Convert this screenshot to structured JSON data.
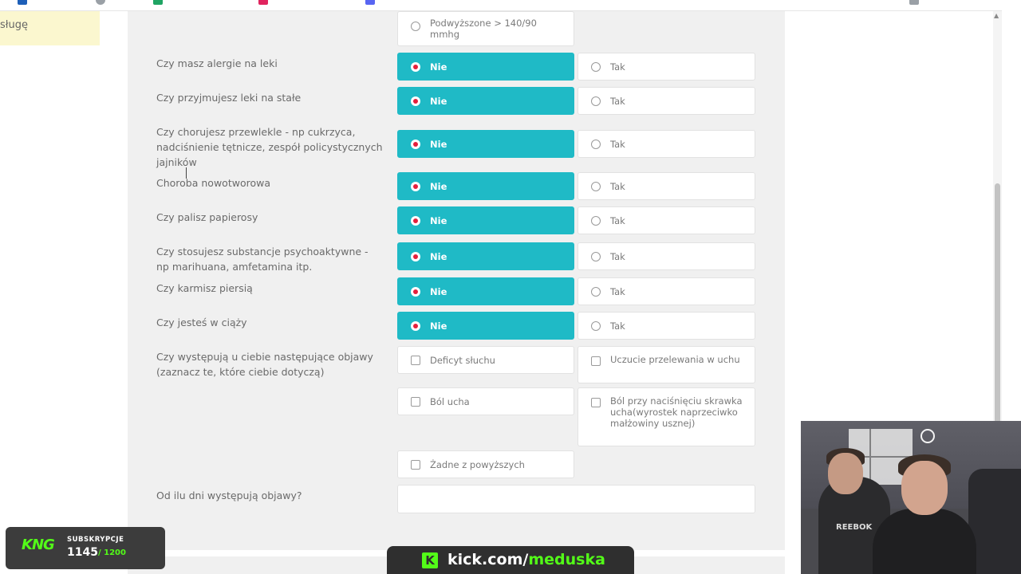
{
  "left_note": {
    "text": "sługę"
  },
  "bp_option": {
    "label": "Podwyższone > 140/90 mmhg"
  },
  "questions": [
    {
      "label": "Czy masz alergie na leki",
      "yes": "Tak",
      "no": "Nie",
      "selected": "Nie"
    },
    {
      "label": "Czy przyjmujesz leki na stałe",
      "yes": "Tak",
      "no": "Nie",
      "selected": "Nie"
    },
    {
      "label": "Czy chorujesz przewlekle - np cukrzyca, nadciśnienie tętnicze, zespół policystycznych jajników",
      "yes": "Tak",
      "no": "Nie",
      "selected": "Nie"
    },
    {
      "label": "Choroba nowotworowa",
      "yes": "Tak",
      "no": "Nie",
      "selected": "Nie"
    },
    {
      "label": "Czy palisz papierosy",
      "yes": "Tak",
      "no": "Nie",
      "selected": "Nie"
    },
    {
      "label": "Czy stosujesz substancje psychoaktywne - np marihuana, amfetamina itp.",
      "yes": "Tak",
      "no": "Nie",
      "selected": "Nie"
    },
    {
      "label": "Czy karmisz piersią",
      "yes": "Tak",
      "no": "Nie",
      "selected": "Nie"
    },
    {
      "label": "Czy jesteś w ciąży",
      "yes": "Tak",
      "no": "Nie",
      "selected": "Nie"
    }
  ],
  "symptoms": {
    "label": "Czy występują u ciebie następujące objawy (zaznacz te, które ciebie dotyczą)",
    "options": [
      "Deficyt słuchu",
      "Uczucie przelewania w uchu",
      "Ból ucha",
      "Ból przy naciśnięciu skrawka ucha(wyrostek naprzeciwko małżowiny usznej)",
      "Żadne z powyższych"
    ]
  },
  "days": {
    "label": "Od ilu dni występują objawy?",
    "value": ""
  },
  "overlay": {
    "subs_logo": "KNG",
    "subs_title": "SUBSKRYPCJE",
    "subs_count": "1145",
    "subs_goal": "/ 1200",
    "kick_host": "kick.com/",
    "kick_channel": "meduska",
    "webcam_brand": "REEBOK",
    "colors": {
      "accent": "#1fbac6",
      "radio_dot": "#e51f3c",
      "kick_green": "#53fc18"
    }
  }
}
